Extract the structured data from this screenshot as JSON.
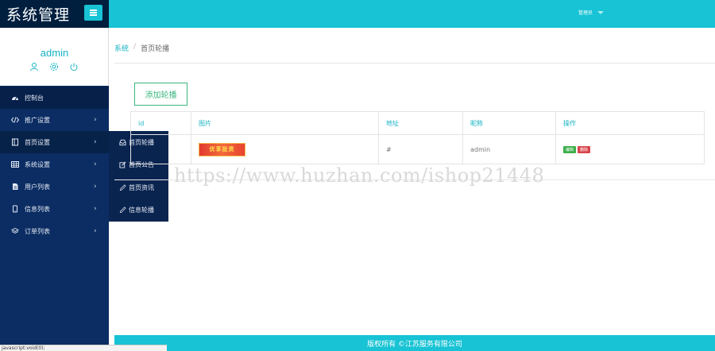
{
  "header": {
    "title": "系统管理",
    "user_menu_label": "管理员"
  },
  "profile": {
    "name": "admin",
    "icons": [
      "user-icon",
      "settings-icon",
      "power-icon"
    ]
  },
  "sidebar": {
    "items": [
      {
        "label": "控制台",
        "icon": "dashboard-icon"
      },
      {
        "label": "推广设置",
        "icon": "code-icon"
      },
      {
        "label": "首页设置",
        "icon": "book-icon"
      },
      {
        "label": "系统设置",
        "icon": "grid-icon"
      },
      {
        "label": "用户列表",
        "icon": "file-icon"
      },
      {
        "label": "信息列表",
        "icon": "tablet-icon"
      },
      {
        "label": "订单列表",
        "icon": "layers-icon"
      }
    ]
  },
  "submenu": {
    "items": [
      {
        "label": "首页轮播",
        "icon": "inbox-icon"
      },
      {
        "label": "首页公告",
        "icon": "edit-icon"
      },
      {
        "label": "首页资讯",
        "icon": "pencil-icon"
      },
      {
        "label": "信息轮播",
        "icon": "pencil-icon"
      }
    ]
  },
  "breadcrumb": {
    "root": "系统",
    "current": "首页轮播"
  },
  "toolbar": {
    "add_label": "添加轮播"
  },
  "table": {
    "headers": [
      "id",
      "图片",
      "地址",
      "昵称",
      "操作"
    ],
    "rows": [
      {
        "id": "",
        "image_text": "优享投资",
        "url": "#",
        "nickname": "admin",
        "edit": "编辑",
        "delete": "删除"
      }
    ]
  },
  "watermark": "https://www.huzhan.com/ishop21448",
  "footer": {
    "copyright": "版权所有 ©江苏服务有限公司"
  },
  "status_bar": {
    "url": "javascript:void(0);"
  },
  "colors": {
    "accent": "#17c3d4",
    "sidebar": "#0b2d63",
    "brand": "#001f3f",
    "success": "#3bb77e",
    "danger": "#d9434b"
  }
}
